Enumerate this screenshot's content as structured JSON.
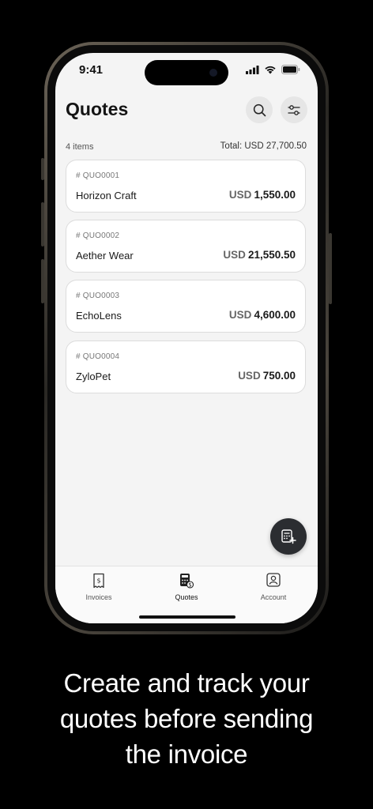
{
  "status": {
    "time": "9:41"
  },
  "header": {
    "title": "Quotes"
  },
  "summary": {
    "count": "4 items",
    "total": "Total: USD 27,700.50"
  },
  "quotes": [
    {
      "number": "# QUO0001",
      "client": "Horizon Craft",
      "currency": "USD",
      "amount": "1,550.00"
    },
    {
      "number": "# QUO0002",
      "client": "Aether Wear",
      "currency": "USD",
      "amount": "21,550.50"
    },
    {
      "number": "# QUO0003",
      "client": "EchoLens",
      "currency": "USD",
      "amount": "4,600.00"
    },
    {
      "number": "# QUO0004",
      "client": "ZyloPet",
      "currency": "USD",
      "amount": "750.00"
    }
  ],
  "tabs": [
    {
      "label": "Invoices",
      "icon": "receipt-icon"
    },
    {
      "label": "Quotes",
      "icon": "quote-calculator-icon",
      "active": true
    },
    {
      "label": "Account",
      "icon": "account-icon"
    }
  ],
  "tagline": {
    "line1": "Create and track your",
    "line2": "quotes before sending",
    "line3": "the invoice"
  },
  "colors": {
    "screen_bg": "#f4f4f4",
    "fab_bg": "#2b2d31",
    "text": "#141414"
  }
}
